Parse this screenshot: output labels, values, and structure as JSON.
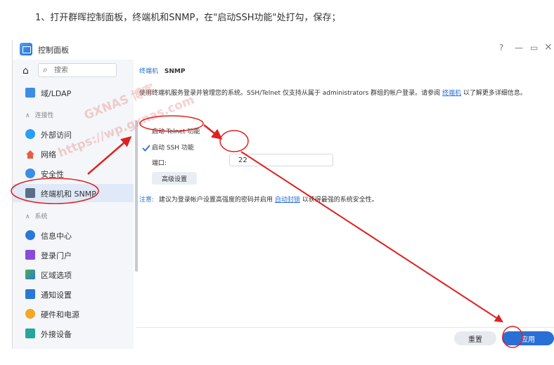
{
  "instruction": "1、打开群晖控制面板，终端机和SNMP，在\"启动SSH功能\"处打勾，保存；",
  "window": {
    "title": "控制面板",
    "help_icon": "?",
    "minimize_icon": "—",
    "maximize_icon": "▭",
    "close_icon": "×"
  },
  "sidebar": {
    "search_placeholder": "搜索",
    "items_top": [
      {
        "label": "域/LDAP",
        "icon": "domain-icon",
        "color": "#3a8ee6"
      }
    ],
    "section_connectivity": "连接性",
    "items_connectivity": [
      {
        "label": "外部访问",
        "icon": "external-access-icon",
        "color": "#2a9df4"
      },
      {
        "label": "网络",
        "icon": "network-icon",
        "color": "#e85d3f"
      },
      {
        "label": "安全性",
        "icon": "security-shield-icon",
        "color": "#3a8ee6"
      },
      {
        "label": "终端机和 SNMP",
        "icon": "terminal-icon",
        "color": "#5a6f86"
      }
    ],
    "section_system": "系统",
    "items_system": [
      {
        "label": "信息中心",
        "icon": "info-icon",
        "color": "#2a78d6"
      },
      {
        "label": "登录门户",
        "icon": "login-portal-icon",
        "color": "#8a4bd8"
      },
      {
        "label": "区域选项",
        "icon": "region-icon",
        "color": "#4caf50"
      },
      {
        "label": "通知设置",
        "icon": "notification-icon",
        "color": "#2a78d6"
      },
      {
        "label": "硬件和电源",
        "icon": "hardware-power-icon",
        "color": "#f5a623"
      },
      {
        "label": "外接设备",
        "icon": "external-device-icon",
        "color": "#26a69a"
      }
    ]
  },
  "content": {
    "breadcrumb_link": "终端机",
    "breadcrumb_current": "SNMP",
    "description": "使用终端机服务登录并管理您的系统。SSH/Telnet 仅支持从属于 administrators 群组的帐户登录。请参阅",
    "description_link": "终端机",
    "description_suffix": "以了解更多详细信息。",
    "telnet_label": "启动 Telnet 功能",
    "ssh_label": "启动 SSH 功能",
    "ssh_checked": true,
    "port_label": "端口:",
    "port_value": "22",
    "advanced_button": "高级设置",
    "note_prefix": "注意:",
    "note_text": "建议为登录帐户设置高强度的密码并启用",
    "note_link": "自动封锁",
    "note_suffix": "以获得最强的系统安全性。"
  },
  "footer": {
    "reset_label": "重置",
    "apply_label": "应用"
  },
  "watermark": {
    "line1": "GXNAS 博客",
    "line2": "https://wp.gxnas.com"
  },
  "colors": {
    "accent": "#2a6fd6",
    "annotation": "#e02020",
    "sidebar_bg": "#f4f6f9"
  }
}
